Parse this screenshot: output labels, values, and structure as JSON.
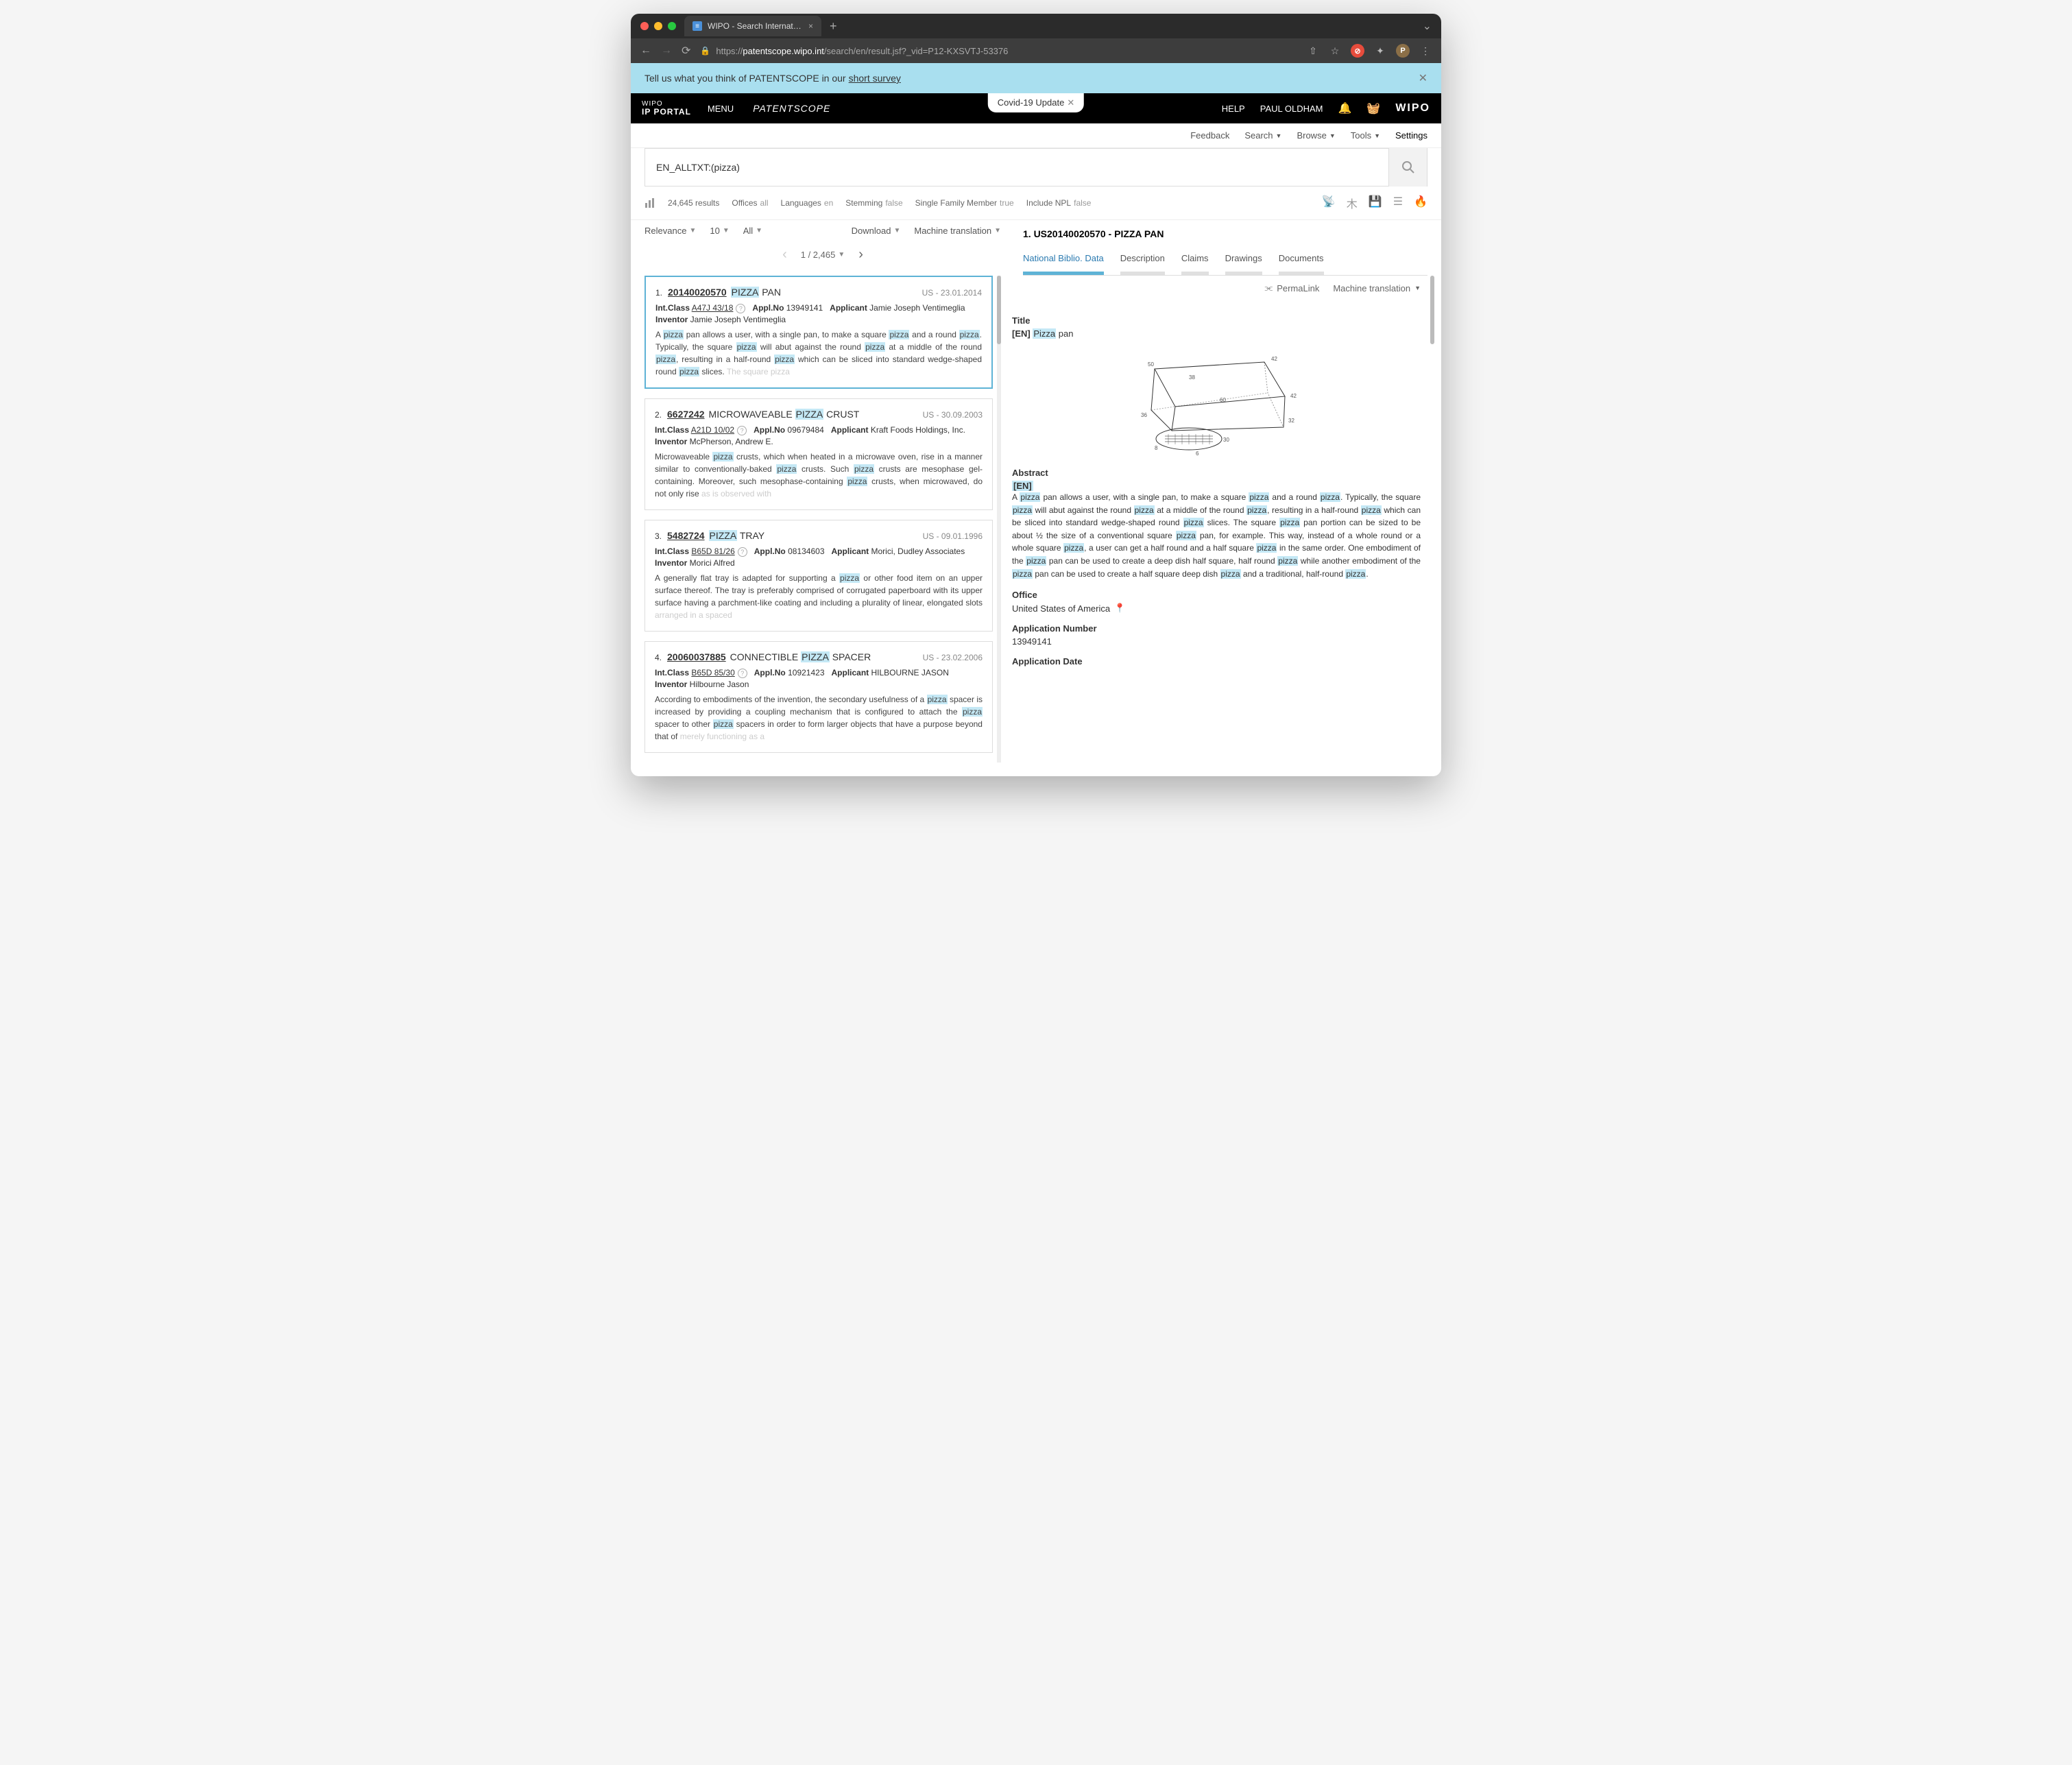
{
  "browser": {
    "tab_title": "WIPO - Search International an",
    "url_prefix": "https://",
    "url_domain": "patentscope.wipo.int",
    "url_path": "/search/en/result.jsf?_vid=P12-KXSVTJ-53376"
  },
  "survey": {
    "prefix": "Tell us what you think of PATENTSCOPE in our ",
    "link": "short survey"
  },
  "nav": {
    "brand_top": "WIPO",
    "brand_bottom": "IP PORTAL",
    "menu": "MENU",
    "patentscope": "PATENTSCOPE",
    "covid": "Covid-19 Update",
    "help": "HELP",
    "user": "PAUL OLDHAM",
    "wipo": "WIPO"
  },
  "secnav": {
    "feedback": "Feedback",
    "search": "Search",
    "browse": "Browse",
    "tools": "Tools",
    "settings": "Settings"
  },
  "search": {
    "value": "EN_ALLTXT:(pizza)"
  },
  "filters": {
    "results": "24,645 results",
    "offices": "Offices",
    "offices_v": "all",
    "languages": "Languages",
    "languages_v": "en",
    "stemming": "Stemming",
    "stemming_v": "false",
    "sfm": "Single Family Member",
    "sfm_v": "true",
    "npl": "Include NPL",
    "npl_v": "false"
  },
  "controls": {
    "sort": "Relevance",
    "size": "10",
    "scope": "All",
    "download": "Download",
    "mt": "Machine translation"
  },
  "pager": {
    "position": "1 / 2,465"
  },
  "results": [
    {
      "n": "1.",
      "id": "20140020570",
      "title_pre": "PIZZA",
      "title_post": " PAN",
      "date": "US - 23.01.2014",
      "intclass": "A47J 43/18",
      "applno": "13949141",
      "applicant": "Jamie Joseph Ventimeglia",
      "inventor": "Jamie Joseph Ventimeglia",
      "abstract": "A |pizza| pan allows a user, with a single pan, to make a square |pizza| and a round |pizza|. Typically, the square |pizza| will abut against the round |pizza| at a middle of the round |pizza|, resulting in a half-round |pizza| which can be sliced into standard wedge-shaped round |pizza| slices. ~The square pizza~"
    },
    {
      "n": "2.",
      "id": "6627242",
      "title_pre_plain": "MICROWAVEABLE ",
      "title_pre": "PIZZA",
      "title_post": " CRUST",
      "date": "US - 30.09.2003",
      "intclass": "A21D 10/02",
      "applno": "09679484",
      "applicant": "Kraft Foods Holdings, Inc.",
      "inventor": "McPherson, Andrew E.",
      "abstract": "Microwaveable |pizza| crusts, which when heated in a microwave oven, rise in a manner similar to conventionally-baked |pizza| crusts. Such |pizza| crusts are mesophase gel-containing. Moreover, such mesophase-containing |pizza| crusts, when microwaved, do not only rise ~as is observed with~"
    },
    {
      "n": "3.",
      "id": "5482724",
      "title_pre": "PIZZA",
      "title_post": " TRAY",
      "date": "US - 09.01.1996",
      "intclass": "B65D 81/26",
      "applno": "08134603",
      "applicant": "Morici, Dudley Associates",
      "inventor": "Morici Alfred",
      "abstract": "A generally flat tray is adapted for supporting a |pizza| or other food item on an upper surface thereof. The tray is preferably comprised of corrugated paperboard with its upper surface having a parchment-like coating and including a plurality of linear, elongated slots ~arranged in a spaced~"
    },
    {
      "n": "4.",
      "id": "20060037885",
      "title_pre_plain": "CONNECTIBLE ",
      "title_pre": "PIZZA",
      "title_post": " SPACER",
      "date": "US - 23.02.2006",
      "intclass": "B65D 85/30",
      "applno": "10921423",
      "applicant": "HILBOURNE JASON",
      "inventor": "Hilbourne Jason",
      "abstract": "According to embodiments of the invention, the secondary usefulness of a |pizza| spacer is increased by providing a coupling mechanism that is configured to attach the |pizza| spacer to other |pizza| spacers in order to form larger objects that have a purpose beyond that of ~merely functioning as a~"
    }
  ],
  "detail": {
    "heading": "1. US20140020570 - PIZZA PAN",
    "tabs": {
      "biblio": "National Biblio. Data",
      "desc": "Description",
      "claims": "Claims",
      "drawings": "Drawings",
      "docs": "Documents"
    },
    "permalink": "PermaLink",
    "mt": "Machine translation",
    "title_label": "Title",
    "title_en": "[EN]",
    "title_pre": "Pizza",
    "title_post": " pan",
    "abstract_label": "Abstract",
    "abstract_en": "[EN]",
    "abstract": "A |pizza| pan allows a user, with a single pan, to make a square |pizza| and a round |pizza|. Typically, the square |pizza| will abut against the round |pizza| at a middle of the round |pizza|, resulting in a half-round |pizza| which can be sliced into standard wedge-shaped round |pizza| slices. The square |pizza| pan portion can be sized to be about ½ the size of a conventional square |pizza| pan, for example. This way, instead of a whole round or a whole square |pizza|, a user can get a half round and a half square |pizza| in the same order. One embodiment of the |pizza| pan can be used to create a deep dish half square, half round |pizza| while another embodiment of the |pizza| pan can be used to create a half square deep dish |pizza| and a traditional, half-round |pizza|.",
    "office_label": "Office",
    "office": "United States of America",
    "appnum_label": "Application Number",
    "appnum": "13949141",
    "appdate_label": "Application Date"
  }
}
